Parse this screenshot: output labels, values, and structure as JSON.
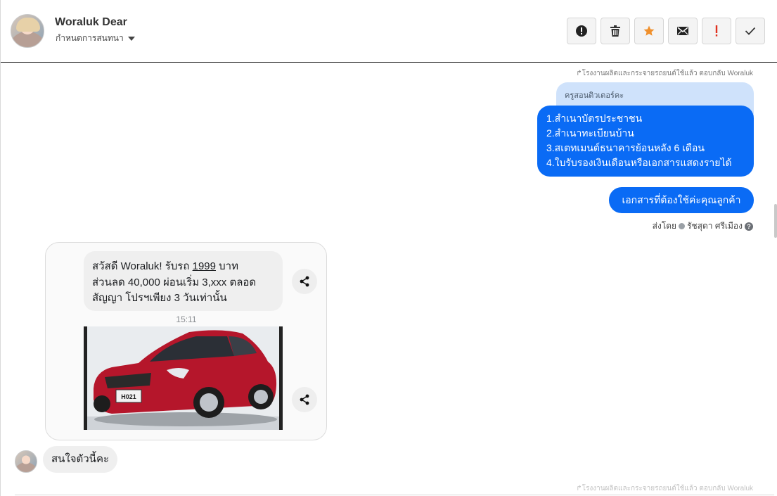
{
  "header": {
    "contact_name": "Woraluk Dear",
    "assign_label": "กำหนดการสนทนา",
    "toolbar": [
      {
        "name": "alert-circle-icon"
      },
      {
        "name": "trash-icon"
      },
      {
        "name": "star-icon",
        "color": "#f0902c"
      },
      {
        "name": "envelope-icon"
      },
      {
        "name": "exclamation-icon",
        "color": "#e0301e"
      },
      {
        "name": "check-icon"
      }
    ]
  },
  "conversation": {
    "reply_note": "↱โรงงานผลิตและกระจายรถยนต์ใช้แล้ว ตอบกลับ Woraluk",
    "quoted_text": "ครูสอนติวเตอร์คะ",
    "outgoing_list": [
      "1.สำเนาบัตรประชาชน",
      "2.สำเนาทะเบียนบ้าน",
      "3.สเตทเมนต์ธนาคารย้อนหลัง 6 เดือน",
      "4.ใบรับรองเงินเดือนหรือเอกสารแสดงรายได้"
    ],
    "outgoing_short": "เอกสารที่ต้องใช้ค่ะคุณลูกค้า",
    "sent_by_label": "ส่งโดย",
    "sent_by_name": "รัชสุดา ศรีเมือง",
    "help_glyph": "?",
    "card": {
      "text_line1_pre": "สวัสดี Woraluk! รับรถ ",
      "text_price": "1999",
      "text_line1_post": " บาท",
      "text_line2": "ส่วนลด 40,000 ผ่อนเริ่ม 3,xxx ตลอด",
      "text_line3": "สัญญา โปรฯเพียง 3 วันเท่านั้น",
      "time": "15:11",
      "plate_text": "H021",
      "car_color": "#b5162b"
    },
    "incoming_text": "สนใจตัวนี้คะ",
    "faded_note": "↱โรงงานผลิตและกระจายรถยนต์ใช้แล้ว ตอบกลับ Woraluk"
  },
  "colors": {
    "outgoing_bubble": "#0a6bf5",
    "quoted_bubble": "#cfe2fb",
    "incoming_bubble": "#efefef"
  }
}
